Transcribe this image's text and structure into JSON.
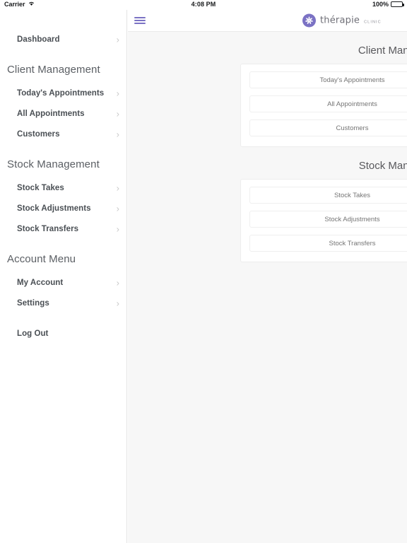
{
  "status_bar": {
    "carrier": "Carrier",
    "wifi_icon": "wifi-icon",
    "time": "4:08 PM",
    "battery_percent": "100%",
    "battery_icon": "battery-full-icon"
  },
  "header": {
    "menu_icon": "hamburger-menu-icon",
    "logo_icon": "therapie-flower-icon",
    "brand_name": "thérapie",
    "brand_subtitle": "clinic"
  },
  "sidebar": {
    "items": [
      {
        "label": "Dashboard",
        "type": "item",
        "chevron": "›"
      }
    ],
    "sections": [
      {
        "title": "Client Management",
        "items": [
          {
            "label": "Today's Appointments",
            "chevron": "›"
          },
          {
            "label": "All Appointments",
            "chevron": "›"
          },
          {
            "label": "Customers",
            "chevron": "›"
          }
        ]
      },
      {
        "title": "Stock Management",
        "items": [
          {
            "label": "Stock Takes",
            "chevron": "›"
          },
          {
            "label": "Stock Adjustments",
            "chevron": "›"
          },
          {
            "label": "Stock Transfers",
            "chevron": "›"
          }
        ]
      },
      {
        "title": "Account Menu",
        "items": [
          {
            "label": "My Account",
            "chevron": "›"
          },
          {
            "label": "Settings",
            "chevron": "›"
          }
        ]
      }
    ],
    "logout": {
      "label": "Log Out"
    }
  },
  "main": {
    "panels": [
      {
        "title": "Client Management",
        "buttons": [
          {
            "label": "Today's Appointments"
          },
          {
            "label": "All Appointments"
          },
          {
            "label": "Customers"
          }
        ]
      },
      {
        "title": "Stock Management",
        "buttons": [
          {
            "label": "Stock Takes"
          },
          {
            "label": "Stock Adjustments"
          },
          {
            "label": "Stock Transfers"
          }
        ]
      }
    ]
  },
  "colors": {
    "accent": "#7b72c4",
    "page_bg": "#f7f7f7",
    "card_bg": "#ffffff",
    "text": "#4a4f54",
    "muted": "#757575"
  }
}
